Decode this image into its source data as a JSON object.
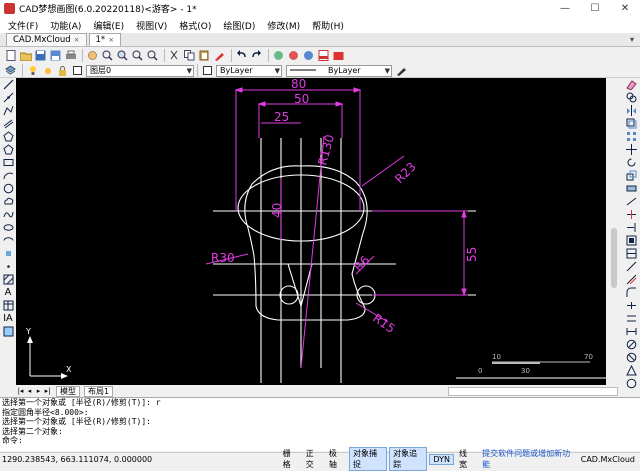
{
  "window": {
    "title": "CAD梦想画图(6.0.20220118)<游客> - 1*",
    "minimize": "—",
    "maximize": "☐",
    "close": "✕"
  },
  "menu": [
    "文件(F)",
    "功能(A)",
    "编辑(E)",
    "视图(V)",
    "格式(O)",
    "绘图(D)",
    "修改(M)",
    "帮助(H)"
  ],
  "tabs": [
    {
      "label": "CAD.MxCloud",
      "close": "×"
    },
    {
      "label": "1*",
      "close": "×"
    }
  ],
  "tab_arrow": "▾",
  "layer_combo": "图层0",
  "color_combo": "ByLayer",
  "linetype_combo": "ByLayer",
  "drawing": {
    "dims": [
      "80",
      "50",
      "25",
      "40",
      "55"
    ],
    "radii": [
      "R130",
      "R23",
      "R30",
      "R6",
      "R15"
    ],
    "ruler": {
      "label10": "10",
      "label70": "70",
      "label0": "0",
      "label30": "30"
    },
    "ucs": {
      "x": "X",
      "y": "Y"
    }
  },
  "layout_tabs": [
    "模型",
    "布局1"
  ],
  "command_lines": [
    "选择第一个对象或 [半径(R)/修剪(T)]: r",
    "指定圆角半径<8.000>:",
    "选择第一个对象或 [半径(R)/修剪(T)]:",
    "选择第二个对象:",
    "命令:"
  ],
  "status": {
    "coords": "1290.238543,  663.111074,  0.000000",
    "buttons": [
      "栅格",
      "正交",
      "极轴",
      "对象捕捉",
      "对象追踪",
      "DYN",
      "线宽"
    ],
    "active": [
      "对象捕捉",
      "对象追踪",
      "DYN"
    ],
    "feedback": "提交软件问题或增加新功能",
    "brand": "CAD.MxCloud"
  }
}
